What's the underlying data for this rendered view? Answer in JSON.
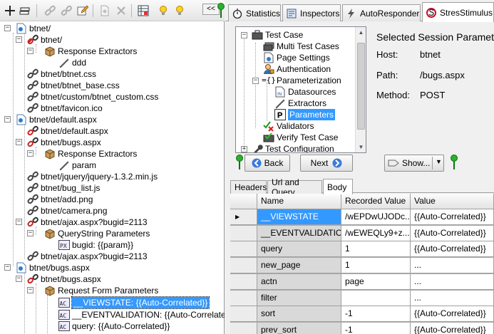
{
  "toolbar": {
    "collapse_label": "<<"
  },
  "session_tree": {
    "nodes": [
      {
        "text": "btnet/"
      },
      {
        "text": "btnet/"
      },
      {
        "text": "Response Extractors"
      },
      {
        "text": "ddd"
      },
      {
        "text": "btnet/btnet.css"
      },
      {
        "text": "btnet/btnet_base.css"
      },
      {
        "text": "btnet/custom/btnet_custom.css"
      },
      {
        "text": "btnet/favicon.ico"
      },
      {
        "text": "btnet/default.aspx"
      },
      {
        "text": "btnet/default.aspx"
      },
      {
        "text": "btnet/bugs.aspx"
      },
      {
        "text": "Response Extractors"
      },
      {
        "text": "param"
      },
      {
        "text": "btnet/jquery/jquery-1.3.2.min.js"
      },
      {
        "text": "btnet/bug_list.js"
      },
      {
        "text": "btnet/add.png"
      },
      {
        "text": "btnet/camera.png"
      },
      {
        "text": "btnet/ajax.aspx?bugid=2113"
      },
      {
        "text": "QueryString Parameters"
      },
      {
        "text": "bugid: {{param}}"
      },
      {
        "text": "btnet/ajax.aspx?bugid=2113"
      },
      {
        "text": "btnet/bugs.aspx"
      },
      {
        "text": "btnet/bugs.aspx"
      },
      {
        "text": "Request Form Parameters"
      },
      {
        "text": "__VIEWSTATE: {{Auto-Correlated}}"
      },
      {
        "text": "__EVENTVALIDATION: {{Auto-Correlated}}"
      },
      {
        "text": "query: {{Auto-Correlated}}"
      }
    ]
  },
  "tabs": [
    {
      "label": "Statistics"
    },
    {
      "label": "Inspectors"
    },
    {
      "label": "AutoResponder"
    },
    {
      "label": "StresStimulus"
    }
  ],
  "settings_tree": {
    "items": [
      {
        "label": "Test Case"
      },
      {
        "label": "Multi Test Cases"
      },
      {
        "label": "Page Settings"
      },
      {
        "label": "Authentication"
      },
      {
        "label": "Parameterization"
      },
      {
        "label": "Datasources"
      },
      {
        "label": "Extractors"
      },
      {
        "label": "Parameters"
      },
      {
        "label": "Validators"
      },
      {
        "label": "Verify Test Case"
      },
      {
        "label": "Test Configuration"
      }
    ]
  },
  "session_info": {
    "title": "Selected Session Parameters",
    "host_label": "Host:",
    "host_value": "btnet",
    "path_label": "Path:",
    "path_value": "/bugs.aspx",
    "method_label": "Method:",
    "method_value": "POST"
  },
  "nav": {
    "back_label": "Back",
    "next_label": "Next",
    "show_label": "Show..."
  },
  "detail_tabs": [
    {
      "label": "Headers"
    },
    {
      "label": "Url and Query"
    },
    {
      "label": "Body"
    }
  ],
  "grid": {
    "columns": [
      "Name",
      "Recorded Value",
      "Value"
    ],
    "rows": [
      {
        "name": "__VIEWSTATE",
        "recorded": "/wEPDwUJODc...",
        "value": "{{Auto-Correlated}}"
      },
      {
        "name": "__EVENTVALIDATION",
        "recorded": "/wEWEQLy9+z...",
        "value": "{{Auto-Correlated}}"
      },
      {
        "name": "query",
        "recorded": "1",
        "value": "{{Auto-Correlated}}"
      },
      {
        "name": "new_page",
        "recorded": "1",
        "value": "..."
      },
      {
        "name": "actn",
        "recorded": "page",
        "value": "..."
      },
      {
        "name": "filter",
        "recorded": "",
        "value": "..."
      },
      {
        "name": "sort",
        "recorded": "-1",
        "value": "{{Auto-Correlated}}"
      },
      {
        "name": "prev_sort",
        "recorded": "-1",
        "value": "{{Auto-Correlated}}"
      }
    ]
  },
  "colors": {
    "selection": "#3399ff",
    "pin_green": "#22aa22"
  }
}
